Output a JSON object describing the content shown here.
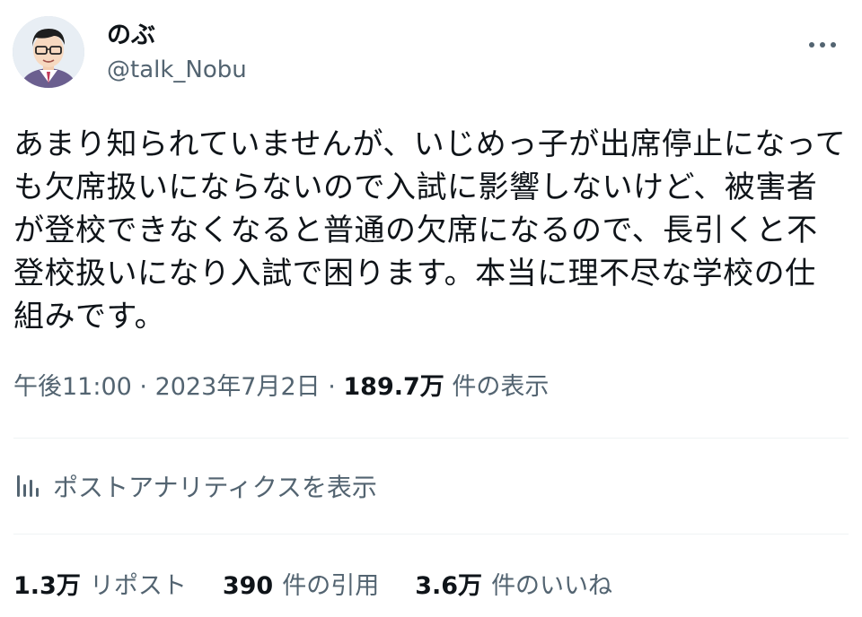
{
  "author": {
    "display_name": "のぶ",
    "handle": "@talk_Nobu"
  },
  "tweet": {
    "text": "あまり知られていませんが、いじめっ子が出席停止になっても欠席扱いにならないので入試に影響しないけど、被害者が登校できなくなると普通の欠席になるので、長引くと不登校扱いになり入試で困ります。本当に理不尽な学校の仕組みです。",
    "time": "午後11:00",
    "separator": " · ",
    "date": "2023年7月2日",
    "views_count": "189.7万",
    "views_label": " 件の表示"
  },
  "analytics": {
    "label": "ポストアナリティクスを表示"
  },
  "stats": {
    "reposts_count": "1.3万",
    "reposts_label": "リポスト",
    "quotes_count": "390",
    "quotes_label": "件の引用",
    "likes_count": "3.6万",
    "likes_label": "件のいいね"
  },
  "icons": {
    "more": "more-horizontal-icon",
    "analytics": "bar-chart-icon",
    "avatar": "avatar-illustration"
  },
  "colors": {
    "text_primary": "#0f1419",
    "text_secondary": "#536471",
    "divider": "#eff3f4"
  }
}
